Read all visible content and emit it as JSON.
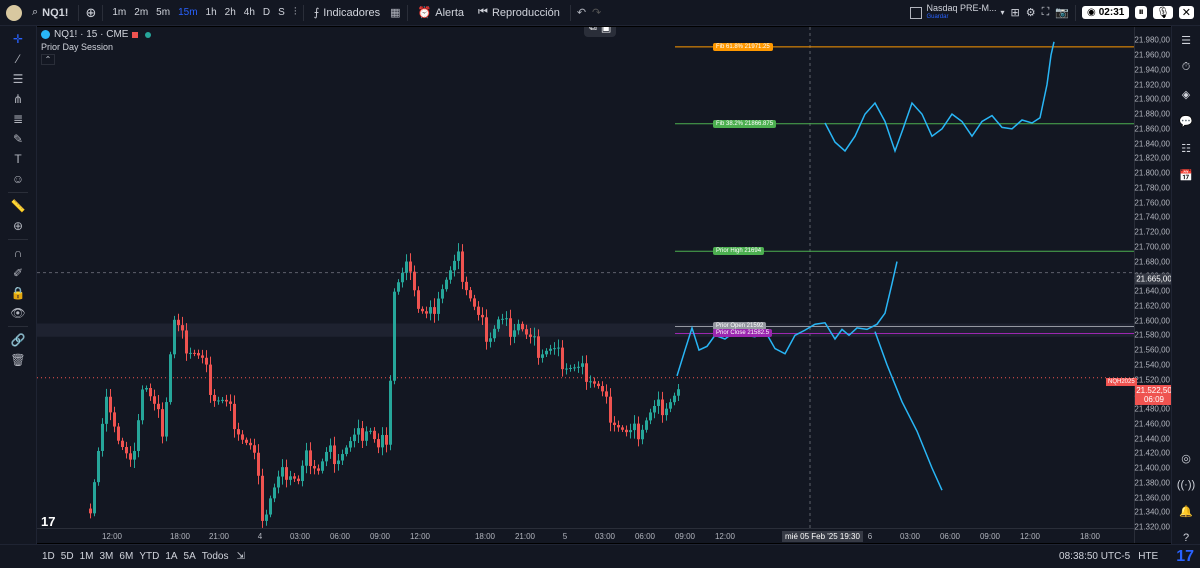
{
  "topbar": {
    "symbol": "NQ1!",
    "timeframes": [
      "1m",
      "2m",
      "5m",
      "15m",
      "1h",
      "2h",
      "4h",
      "D",
      "S"
    ],
    "active_timeframe": "15m",
    "indicators_label": "Indicadores",
    "alert_label": "Alerta",
    "replay_label": "Reproducción",
    "session_name": "Nasdaq PRE-M...",
    "session_sub": "Guardar",
    "timer": "02:31"
  },
  "legend": {
    "symbol_line": "NQ1! · 15 · CME",
    "indicator_name": "Prior Day Session"
  },
  "price_axis": {
    "ticks": [
      "21.980,00",
      "21.960,00",
      "21.940,00",
      "21.920,00",
      "21.900,00",
      "21.880,00",
      "21.860,00",
      "21.840,00",
      "21.820,00",
      "21.800,00",
      "21.780,00",
      "21.760,00",
      "21.740,00",
      "21.720,00",
      "21.700,00",
      "21.680,00",
      "21.660,00",
      "21.640,00",
      "21.620,00",
      "21.600,00",
      "21.580,00",
      "21.560,00",
      "21.540,00",
      "21.520,00",
      "21.500,00",
      "21.480,00",
      "21.460,00",
      "21.440,00",
      "21.420,00",
      "21.400,00",
      "21.380,00",
      "21.360,00",
      "21.340,00",
      "21.320,00"
    ],
    "crosshair_price": "21.665,00",
    "last_price": "21.522,50",
    "countdown": "06:09",
    "last_price_symbol": "NQH2025"
  },
  "time_axis": {
    "labels": [
      "12:00",
      "18:00",
      "21:00",
      "4",
      "03:00",
      "06:00",
      "09:00",
      "12:00",
      "18:00",
      "21:00",
      "5",
      "03:00",
      "06:00",
      "09:00",
      "12:00",
      "6",
      "03:00",
      "06:00",
      "09:00",
      "12:00",
      "18:00"
    ],
    "cursor_label": "mié 05 Feb '25   19:30"
  },
  "levels": {
    "fib_top": "Fib 61.8% 21971.25",
    "fib_mid": "Fib 38.2% 21866.875",
    "prior_high": "Prior High 21694",
    "prior_open": "Prior Open 21592",
    "prior_close": "Prior Close 21582.5"
  },
  "bottombar": {
    "ranges": [
      "1D",
      "5D",
      "1M",
      "3M",
      "6M",
      "YTD",
      "1A",
      "5A",
      "Todos"
    ],
    "clock": "08:38:50 UTC-5",
    "extra": "HTE"
  },
  "colors": {
    "bg": "#131722",
    "up": "#26a69a",
    "down": "#ef5350",
    "fib": "#ff9800",
    "prior_high": "#4caf50",
    "prior_close": "#9c27b0",
    "drawing": "#29b6f6"
  },
  "chart_data": {
    "type": "candlestick",
    "symbol": "NQ1!",
    "interval": "15",
    "ylim": [
      21320,
      21990
    ],
    "horizontal_levels": [
      {
        "label": "Fib 61.8%",
        "value": 21971.25
      },
      {
        "label": "Fib 38.2%",
        "value": 21866.875
      },
      {
        "label": "Prior High",
        "value": 21694
      },
      {
        "label": "Prior Open",
        "value": 21592
      },
      {
        "label": "Prior Close",
        "value": 21582.5
      }
    ],
    "last_price": 21522.5
  }
}
